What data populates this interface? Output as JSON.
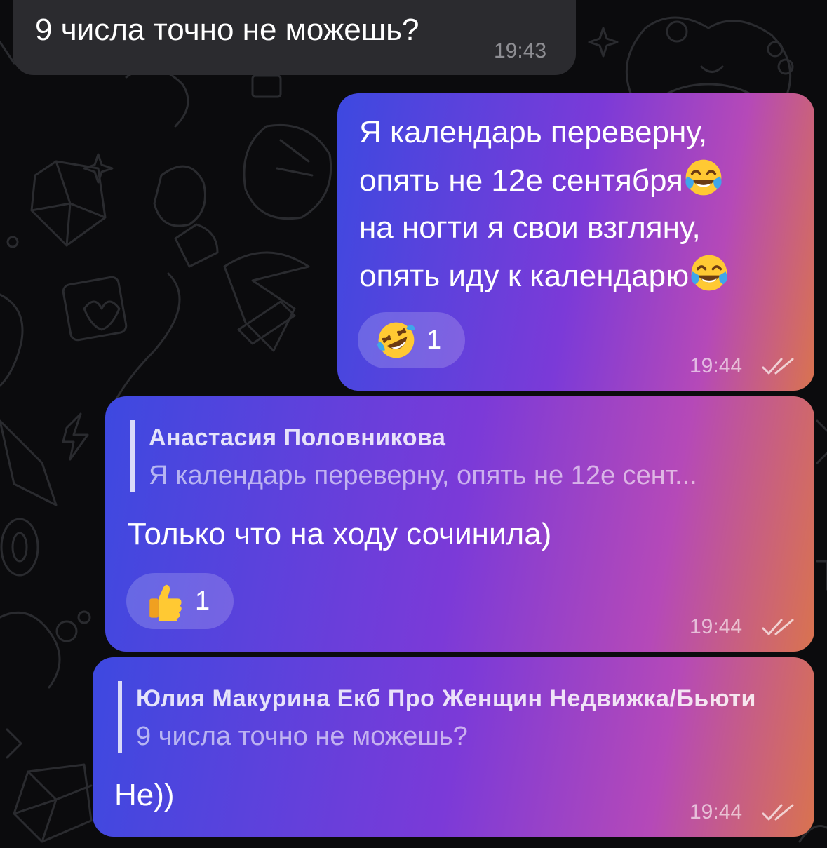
{
  "messages": [
    {
      "id": "m1",
      "direction": "incoming",
      "text": "9 числа точно не можешь?",
      "time": "19:43"
    },
    {
      "id": "m2",
      "direction": "outgoing",
      "lines": [
        "Я календарь переверну,",
        "опять не 12е сентября",
        "на ногти я свои взгляну,",
        "опять иду к календарю"
      ],
      "line_emojis": [
        "",
        "face-with-tears-of-joy-emoji",
        "",
        "face-with-tears-of-joy-emoji"
      ],
      "reaction": {
        "emoji": "rolling-on-floor-laughing-emoji",
        "count": "1"
      },
      "time": "19:44",
      "status": "read-double-check"
    },
    {
      "id": "m3",
      "direction": "outgoing",
      "reply_to": {
        "name": "Анастасия Половникова",
        "text": "Я календарь переверну, опять не 12е сент..."
      },
      "text": "Только что на ходу сочинила)",
      "reaction": {
        "emoji": "thumbs-up-emoji",
        "count": "1"
      },
      "time": "19:44",
      "status": "read-double-check"
    },
    {
      "id": "m4",
      "direction": "outgoing",
      "reply_to": {
        "name": "Юлия Макурина Екб Про Женщин Недвижка/Бьюти",
        "text": "9 числа точно не можешь?"
      },
      "text": "Не))",
      "time": "19:44",
      "status": "read-double-check"
    }
  ],
  "colors": {
    "background": "#0b0b0d",
    "incoming_bubble": "#2b2b2f",
    "outgoing_gradient_start": "#3d49e0",
    "outgoing_gradient_end": "#d9734f"
  }
}
